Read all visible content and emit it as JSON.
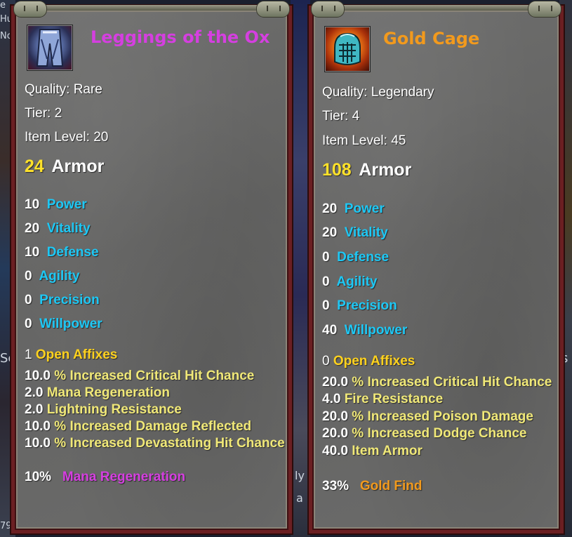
{
  "colors": {
    "rare": "#d53fe0",
    "legendary": "#f29a1d",
    "stat": "#1ec8f5",
    "affix": "#f0e878",
    "armor": "#ffe22a"
  },
  "left_item": {
    "icon": "leggings-armor-icon",
    "name": "Leggings of the Ox",
    "quality": "Quality: Rare",
    "tier": "Tier: 2",
    "item_level": "Item Level: 20",
    "armor_value": "24",
    "armor_label": "Armor",
    "stats": [
      {
        "value": "10",
        "name": "Power"
      },
      {
        "value": "20",
        "name": "Vitality"
      },
      {
        "value": "10",
        "name": "Defense"
      },
      {
        "value": "0",
        "name": "Agility"
      },
      {
        "value": "0",
        "name": "Precision"
      },
      {
        "value": "0",
        "name": "Willpower"
      }
    ],
    "open_affixes_count": "1",
    "open_affixes_label": "Open Affixes",
    "affixes": [
      {
        "value": "10.0",
        "text": "% Increased Critical Hit Chance"
      },
      {
        "value": "2.0",
        "text": "Mana Regeneration"
      },
      {
        "value": "2.0",
        "text": "Lightning Resistance"
      },
      {
        "value": "10.0",
        "text": "% Increased Damage Reflected"
      },
      {
        "value": "10.0",
        "text": "% Increased Devastating Hit Chance"
      }
    ],
    "bonus_value": "10%",
    "bonus_text": "Mana Regeneration"
  },
  "right_item": {
    "icon": "helmet-cage-icon",
    "name": "Gold Cage",
    "quality": "Quality: Legendary",
    "tier": "Tier: 4",
    "item_level": "Item Level: 45",
    "armor_value": "108",
    "armor_label": "Armor",
    "stats": [
      {
        "value": "20",
        "name": "Power"
      },
      {
        "value": "20",
        "name": "Vitality"
      },
      {
        "value": "0",
        "name": "Defense"
      },
      {
        "value": "0",
        "name": "Agility"
      },
      {
        "value": "0",
        "name": "Precision"
      },
      {
        "value": "40",
        "name": "Willpower"
      }
    ],
    "open_affixes_count": "0",
    "open_affixes_label": "Open Affixes",
    "affixes": [
      {
        "value": "20.0",
        "text": "% Increased Critical Hit Chance"
      },
      {
        "value": "4.0",
        "text": "Fire Resistance"
      },
      {
        "value": "20.0",
        "text": "% Increased Poison Damage"
      },
      {
        "value": "20.0",
        "text": "% Increased Dodge Chance"
      },
      {
        "value": "40.0",
        "text": "Item Armor"
      }
    ],
    "bonus_value": "33%",
    "bonus_text": "Gold Find"
  },
  "background": {
    "fragments": [
      "e",
      "Hu",
      "No",
      "Se",
      "s",
      "ly",
      "a",
      "79"
    ]
  }
}
